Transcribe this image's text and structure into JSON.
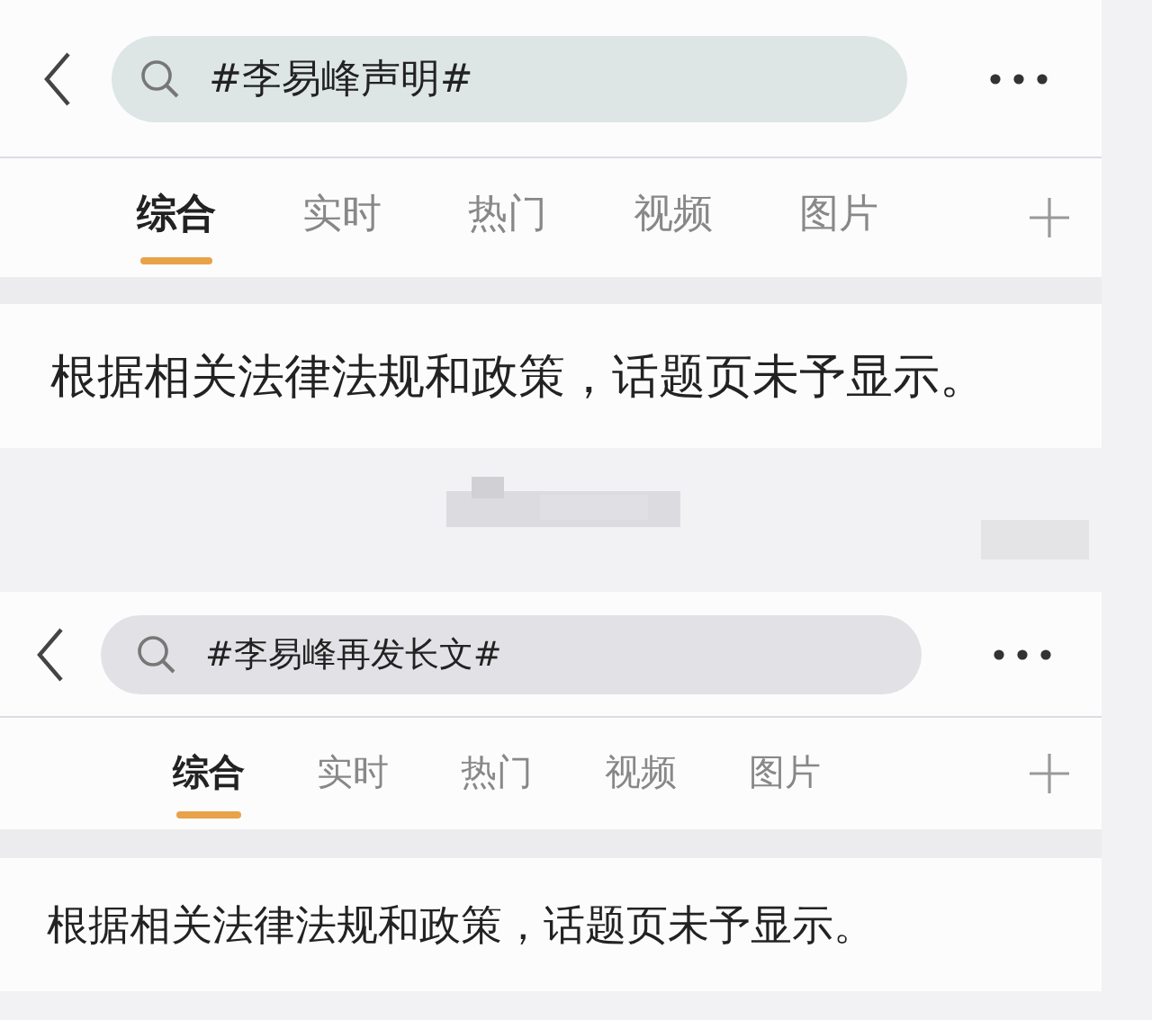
{
  "panels": [
    {
      "search": {
        "value": "#李易峰声明#"
      },
      "tabs": [
        {
          "label": "综合",
          "selected": true
        },
        {
          "label": "实时",
          "selected": false
        },
        {
          "label": "热门",
          "selected": false
        },
        {
          "label": "视频",
          "selected": false
        },
        {
          "label": "图片",
          "selected": false
        }
      ],
      "message": "根据相关法律法规和政策，话题页未予显示。"
    },
    {
      "search": {
        "value": "#李易峰再发长文#"
      },
      "tabs": [
        {
          "label": "综合",
          "selected": true
        },
        {
          "label": "实时",
          "selected": false
        },
        {
          "label": "热门",
          "selected": false
        },
        {
          "label": "视频",
          "selected": false
        },
        {
          "label": "图片",
          "selected": false
        }
      ],
      "message": "根据相关法律法规和政策，话题页未予显示。"
    }
  ]
}
